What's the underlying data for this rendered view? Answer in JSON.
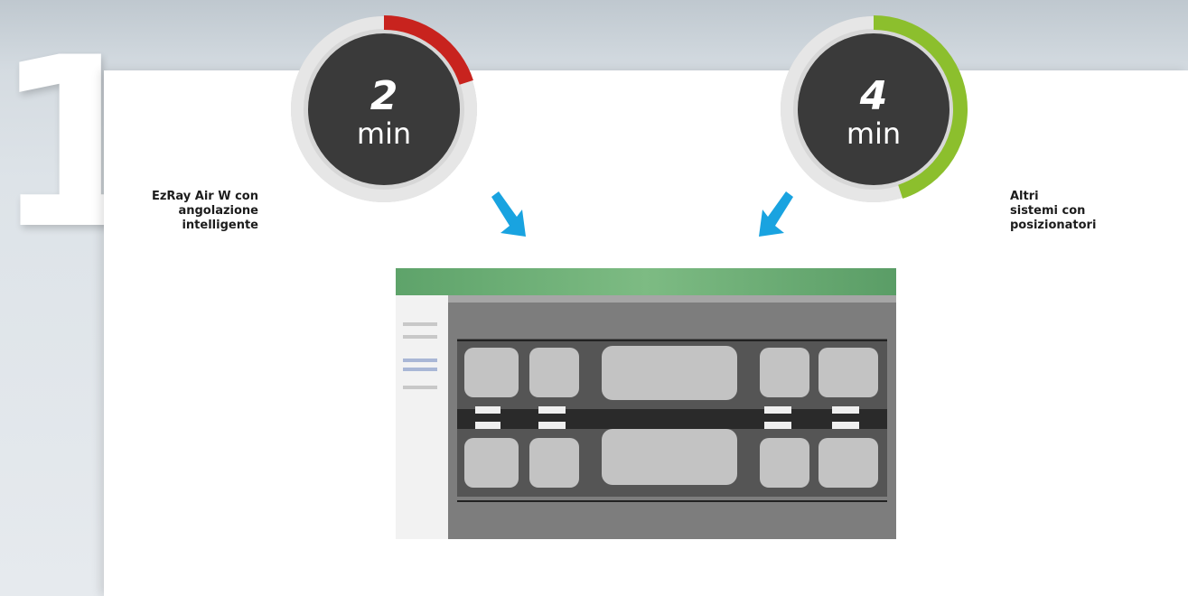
{
  "step_number": "1",
  "timers": [
    {
      "number": "2",
      "unit": "min",
      "accent": "#c8231e",
      "fraction": 0.2
    },
    {
      "number": "4",
      "unit": "min",
      "accent": "#8cbf2d",
      "fraction": 0.45
    }
  ],
  "labels": {
    "left": [
      "EzRay Air W con",
      "angolazione",
      "intelligente"
    ],
    "right": [
      "Altri",
      "sistemi con",
      "posizionatori"
    ]
  },
  "colors": {
    "arrow": "#19a3e0",
    "timer_face": "#3a3a3a",
    "timer_ring": "#dedede",
    "software_header": "#6aae70"
  }
}
